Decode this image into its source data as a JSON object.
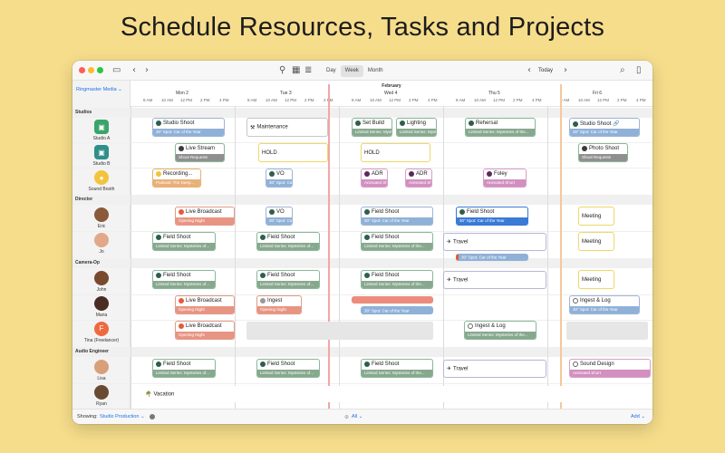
{
  "headline": "Schedule Resources, Tasks and Projects",
  "toolbar": {
    "views": [
      "Day",
      "Week",
      "Month"
    ],
    "active_view": "Week",
    "today_label": "Today"
  },
  "sidebar": {
    "scope_label": "Ringmaster Media ⌄",
    "groups": [
      "Studios",
      "Director",
      "Camera-Op",
      "Audio Engineer"
    ],
    "resources": [
      "Studio A",
      "Studio B",
      "Sound Booth",
      "Eric",
      "Jo",
      "John",
      "Maria",
      "Tina (Freelancer)",
      "Lisa",
      "Ryan"
    ]
  },
  "calendar": {
    "month": "February",
    "days": [
      "Mon 2",
      "Tue 3",
      "Wed 4",
      "Thu 5",
      "Fri 6"
    ],
    "hours": [
      "8 AM",
      "10 AM",
      "12 PM",
      "2 PM",
      "4 PM"
    ]
  },
  "events": {
    "studio_shoot": "Studio Shoot",
    "studio_shoot_sub": "30\" Spot: Car of the Year",
    "maintenance": "Maintenance",
    "set_build": "Set Build",
    "set_build_sub": "Limited Series: Mysteries of...",
    "lighting": "Lighting",
    "lighting_sub": "Limited Series: Mysteries of...",
    "rehersal": "Rehersal",
    "rehersal_sub": "Limited Series: Mysteries of the...",
    "studio_shoot2": "Studio Shoot 🔗",
    "studio_shoot2_sub": "30\" Spot: Car of the Year",
    "live_stream": "Live Stream",
    "live_stream_sub": "Shoot Requests",
    "hold1": "HOLD",
    "hold2": "HOLD",
    "photo_shoot": "Photo Shoot",
    "photo_shoot_sub": "Shoot Requests",
    "recording": "Recording...",
    "recording_sub": "Podcast: The Deep...",
    "vo1": "VO",
    "vo1_sub": "30\" Spot: Car of...",
    "adr1": "ADR",
    "adr1_sub": "Animated Short",
    "adr2": "ADR",
    "adr2_sub": "Animated Short",
    "foley": "Foley",
    "foley_sub": "Animated Short",
    "live_broadcast1": "Live Broadcast",
    "live_broadcast1_sub": "Opening Night",
    "vo2": "VO",
    "vo2_sub": "30\" Spot: Car of...",
    "field_shoot_w1": "Field Shoot",
    "field_shoot_w1_sub": "30\" Spot: Car of the Year",
    "field_shoot_th1": "Field Shoot",
    "field_shoot_th1_sub": "30\" Spot: Car of the Year",
    "meeting1": "Meeting",
    "field_shoot_jo1": "Field Shoot",
    "field_shoot_jo1_sub": "Limited Series: Mysteries of...",
    "field_shoot_jo2": "Field Shoot",
    "field_shoot_jo2_sub": "Limited Series: Mysteries of...",
    "field_shoot_jo3": "Field Shoot",
    "field_shoot_jo3_sub": "Limited Series: Mysteries of the...",
    "travel1": "Travel",
    "travel1_sub": "30\" Spot: Car of the Year",
    "meeting2": "Meeting",
    "field_shoot_john1": "Field Shoot",
    "field_shoot_john1_sub": "Limited Series: Mysteries of...",
    "field_shoot_john2": "Field Shoot",
    "field_shoot_john2_sub": "Limited Series: Mysteries of...",
    "field_shoot_john3": "Field Shoot",
    "field_shoot_john3_sub": "Limited Series: Mysteries of the...",
    "travel2": "Travel",
    "meeting3": "Meeting",
    "live_broadcast2": "Live Broadcast",
    "live_broadcast2_sub": "Opening Night",
    "ingest": "Ingest",
    "ingest_sub": "Opening Night",
    "maria_wed_sub": "30\" Spot: Car of the Year",
    "ingest_log1": "Ingest & Log",
    "ingest_log1_sub": "30\" Spot: Car of the Year",
    "live_broadcast3": "Live Broadcast",
    "live_broadcast3_sub": "Opening Night",
    "ingest_log2": "Ingest & Log",
    "ingest_log2_sub": "Limited Series: Mysteries of the...",
    "field_shoot_lisa1": "Field Shoot",
    "field_shoot_lisa1_sub": "Limited Series: Mysteries of...",
    "field_shoot_lisa2": "Field Shoot",
    "field_shoot_lisa2_sub": "Limited Series: Mysteries of...",
    "field_shoot_lisa3": "Field Shoot",
    "field_shoot_lisa3_sub": "Limited Series: Mysteries of the...",
    "travel3": "Travel",
    "sound_design": "Sound Design",
    "sound_design_sub": "Animated Short",
    "vacation": "Vacation"
  },
  "statusbar": {
    "showing_label": "Showing:",
    "showing_value": "Studio Production ⌄",
    "filter_value": "All ⌄",
    "add_label": "Add ⌄"
  }
}
